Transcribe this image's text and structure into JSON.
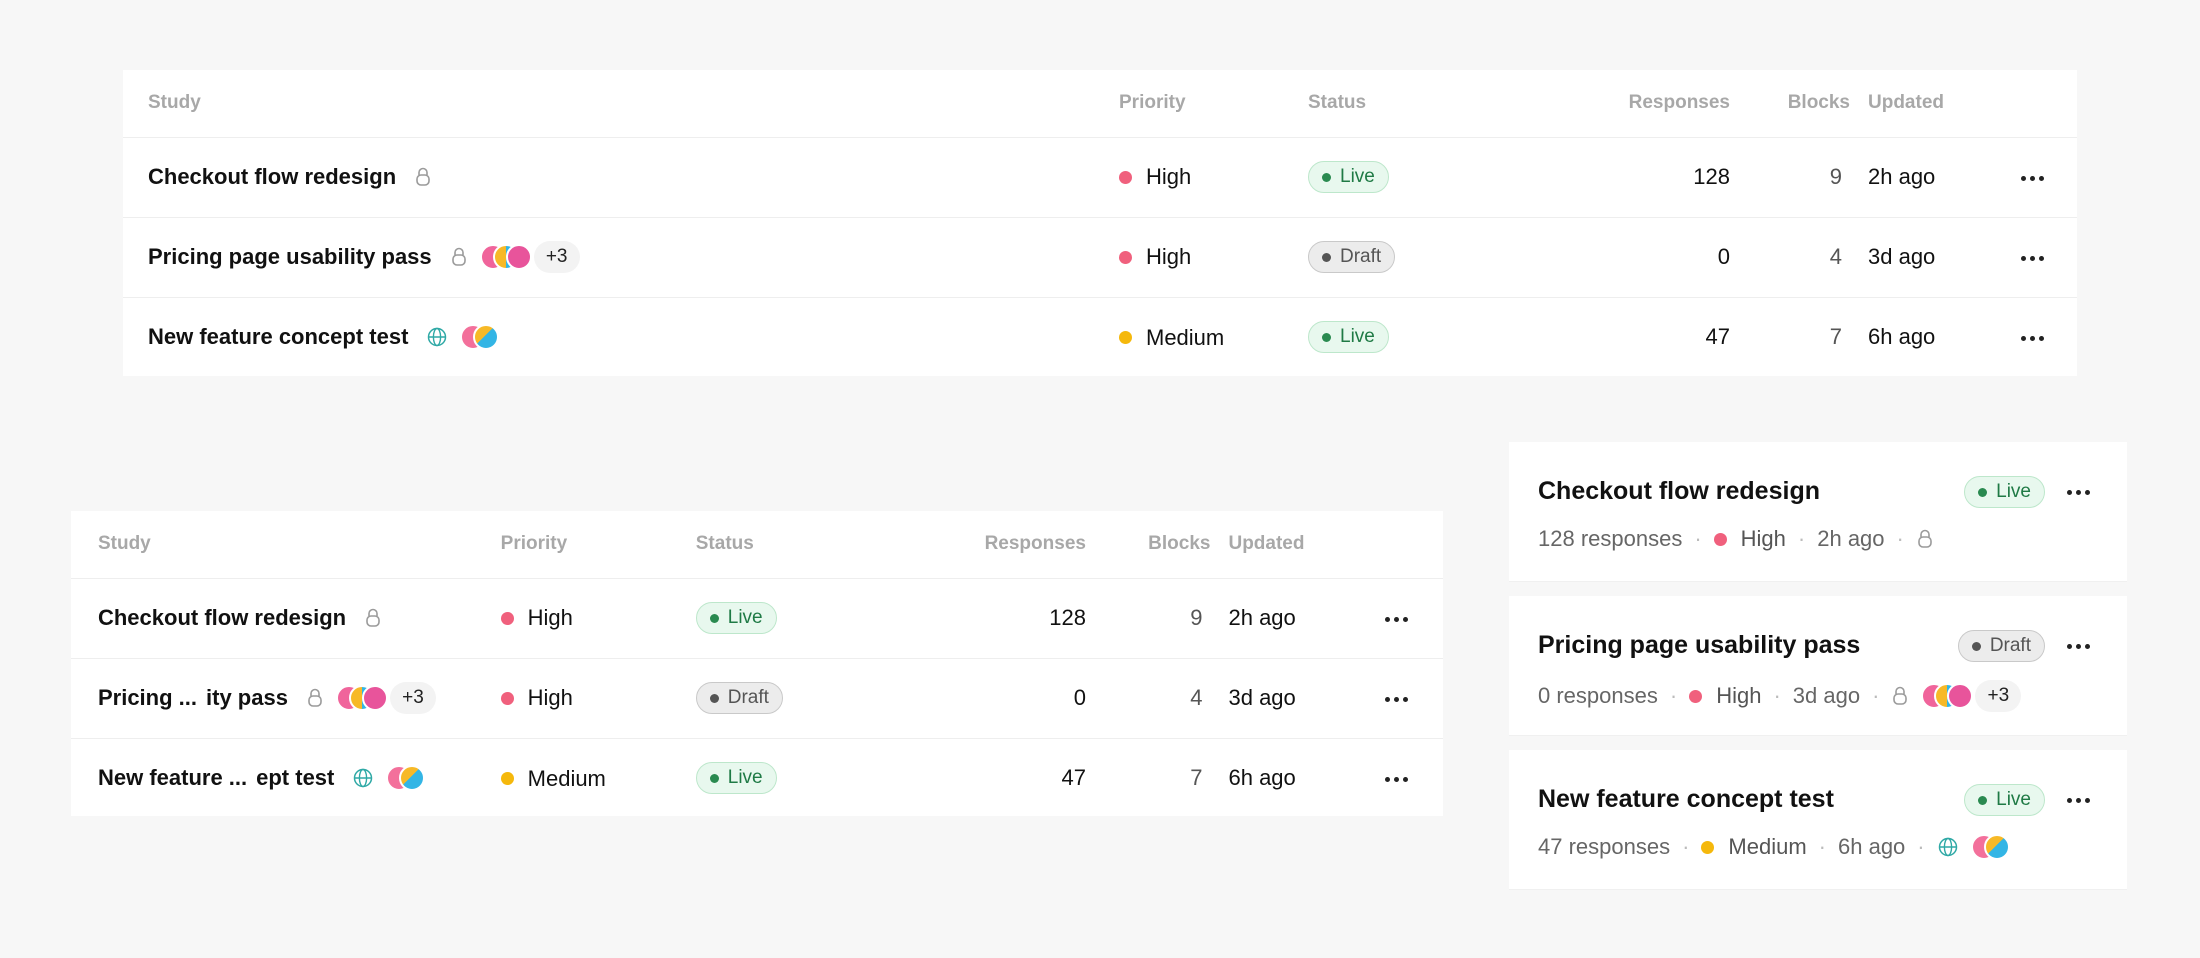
{
  "table": {
    "headers": {
      "study": "Study",
      "priority": "Priority",
      "status": "Status",
      "responses": "Responses",
      "blocks": "Blocks",
      "updated": "Updated"
    },
    "rows": [
      {
        "name": "Checkout flow redesign",
        "name_short_a": "Checkout flow redesign",
        "name_short_b": "",
        "access_icon": "lock-icon",
        "priority": "High",
        "priority_color": "#f0607d",
        "status": "Live",
        "responses": "128",
        "blocks": "9",
        "updated": "2h ago",
        "collaborators": [],
        "extra_count": ""
      },
      {
        "name": "Pricing page usability pass",
        "name_short_a": "Pricing ...",
        "name_short_b": "ity pass",
        "access_icon": "lock-icon",
        "priority": "High",
        "priority_color": "#f0607d",
        "status": "Draft",
        "responses": "0",
        "blocks": "4",
        "updated": "3d ago",
        "collaborators": [
          "#f0649b",
          "#f7b927",
          "#e8549b"
        ],
        "extra_count": "+3"
      },
      {
        "name": "New feature concept test",
        "name_short_a": "New feature ...",
        "name_short_b": "ept test",
        "access_icon": "globe-icon",
        "priority": "Medium",
        "priority_color": "#f5b80c",
        "status": "Live",
        "responses": "47",
        "blocks": "7",
        "updated": "6h ago",
        "collaborators": [
          "#f3709b",
          "#f7b927"
        ],
        "extra_count": ""
      }
    ]
  },
  "cards": [
    {
      "title": "Checkout flow redesign",
      "status": "Live",
      "responses": "128 responses",
      "priority": "High",
      "priority_color": "#f0607d",
      "updated": "2h ago",
      "access_icon": "lock-icon"
    },
    {
      "title": "Pricing page usability pass",
      "status": "Draft",
      "responses": "0 responses",
      "priority": "High",
      "priority_color": "#f0607d",
      "updated": "3d ago",
      "access_icon": "lock-icon",
      "extra_count": "+3"
    },
    {
      "title": "New feature concept test",
      "status": "Live",
      "responses": "47 responses",
      "priority": "Medium",
      "priority_color": "#f5b80c",
      "updated": "6h ago",
      "access_icon": "globe-icon"
    }
  ],
  "colors": {
    "live_bg": "#e8f8ee",
    "live_text": "#1f7a45",
    "draft_bg": "#ececec",
    "draft_text": "#555555",
    "high": "#f0607d",
    "medium": "#f5b80c"
  }
}
